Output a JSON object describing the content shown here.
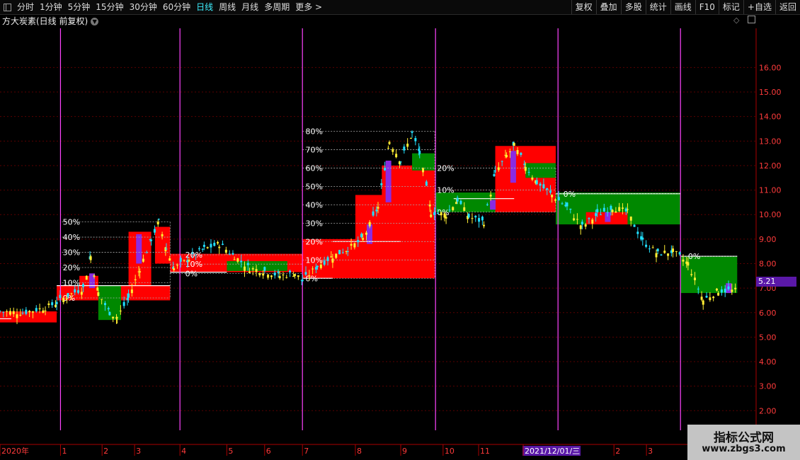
{
  "toolbar": {
    "periods": [
      "分时",
      "1分钟",
      "5分钟",
      "15分钟",
      "30分钟",
      "60分钟",
      "日线",
      "周线",
      "月线",
      "多周期",
      "更多"
    ],
    "active_period": "日线",
    "more_arrow": ">",
    "buttons": [
      "复权",
      "叠加",
      "多股",
      "统计",
      "画线",
      "F10",
      "标记",
      "+自选",
      "返回"
    ]
  },
  "title": {
    "stock": "方大炭素(日线 前复权)"
  },
  "price_axis": {
    "ticks": [
      "16.00",
      "15.00",
      "14.00",
      "13.00",
      "12.00",
      "11.00",
      "10.00",
      "9.00",
      "8.00",
      "7.00",
      "6.00",
      "5.00",
      "4.00",
      "3.00",
      "2.00"
    ]
  },
  "current_price": "5.21",
  "date_axis": {
    "labels": [
      "2020年",
      "1",
      "2",
      "3",
      "4",
      "5",
      "6",
      "7",
      "8",
      "9",
      "10",
      "11",
      "2021/12/01/三",
      "2",
      "3"
    ]
  },
  "chart_data": {
    "type": "candlestick",
    "y_range": [
      1.2,
      17.6
    ],
    "boxes": [
      {
        "x0": 0,
        "x1": 0.075,
        "lo": 5.6,
        "hi": 6.05,
        "color": "#ff0000"
      },
      {
        "x0": 0.075,
        "x1": 0.225,
        "lo": 6.5,
        "hi": 7.1,
        "color": "#ff0000"
      },
      {
        "x0": 0.105,
        "x1": 0.13,
        "lo": 7.0,
        "hi": 7.5,
        "color": "#ff0000"
      },
      {
        "x0": 0.13,
        "x1": 0.16,
        "lo": 5.7,
        "hi": 7.1,
        "color": "#008800"
      },
      {
        "x0": 0.17,
        "x1": 0.2,
        "lo": 7.0,
        "hi": 9.3,
        "color": "#ff0000"
      },
      {
        "x0": 0.205,
        "x1": 0.225,
        "lo": 8.0,
        "hi": 9.5,
        "color": "#ff0000"
      },
      {
        "x0": 0.225,
        "x1": 0.4,
        "lo": 7.65,
        "hi": 8.4,
        "color": "#ff0000"
      },
      {
        "x0": 0.3,
        "x1": 0.38,
        "lo": 7.7,
        "hi": 8.1,
        "color": "#008800"
      },
      {
        "x0": 0.4,
        "x1": 0.575,
        "lo": 7.4,
        "hi": 9.0,
        "color": "#ff0000"
      },
      {
        "x0": 0.47,
        "x1": 0.575,
        "lo": 8.9,
        "hi": 10.8,
        "color": "#ff0000"
      },
      {
        "x0": 0.505,
        "x1": 0.575,
        "lo": 10.5,
        "hi": 12.0,
        "color": "#ff0000"
      },
      {
        "x0": 0.545,
        "x1": 0.575,
        "lo": 11.8,
        "hi": 12.5,
        "color": "#008800"
      },
      {
        "x0": 0.575,
        "x1": 0.735,
        "lo": 10.1,
        "hi": 10.9,
        "color": "#008800"
      },
      {
        "x0": 0.655,
        "x1": 0.735,
        "lo": 10.1,
        "hi": 12.8,
        "color": "#ff0000"
      },
      {
        "x0": 0.695,
        "x1": 0.735,
        "lo": 11.5,
        "hi": 12.1,
        "color": "#008800"
      },
      {
        "x0": 0.735,
        "x1": 0.9,
        "lo": 9.6,
        "hi": 10.9,
        "color": "#008800"
      },
      {
        "x0": 0.775,
        "x1": 0.83,
        "lo": 9.6,
        "hi": 10.1,
        "color": "#ff0000"
      },
      {
        "x0": 0.9,
        "x1": 0.975,
        "lo": 6.8,
        "hi": 8.3,
        "color": "#008800"
      }
    ],
    "period_lines": [
      0.08,
      0.238,
      0.4,
      0.576,
      0.738,
      0.9
    ],
    "levels": [
      "0%",
      "10%",
      "20%",
      "30%",
      "40%",
      "50%",
      "60%",
      "70%",
      "80%"
    ],
    "price_path": [
      [
        0,
        6.05
      ],
      [
        0.03,
        6.0
      ],
      [
        0.06,
        6.2
      ],
      [
        0.075,
        6.4
      ],
      [
        0.09,
        6.7
      ],
      [
        0.11,
        7.0
      ],
      [
        0.12,
        8.3
      ],
      [
        0.13,
        6.8
      ],
      [
        0.145,
        6.0
      ],
      [
        0.155,
        5.8
      ],
      [
        0.17,
        6.6
      ],
      [
        0.185,
        7.8
      ],
      [
        0.2,
        9.0
      ],
      [
        0.21,
        9.7
      ],
      [
        0.22,
        8.6
      ],
      [
        0.23,
        7.8
      ],
      [
        0.25,
        8.2
      ],
      [
        0.27,
        8.6
      ],
      [
        0.29,
        8.8
      ],
      [
        0.31,
        8.3
      ],
      [
        0.33,
        7.8
      ],
      [
        0.35,
        7.7
      ],
      [
        0.37,
        7.5
      ],
      [
        0.39,
        7.6
      ],
      [
        0.4,
        7.3
      ],
      [
        0.42,
        7.9
      ],
      [
        0.44,
        8.3
      ],
      [
        0.46,
        8.6
      ],
      [
        0.48,
        9.0
      ],
      [
        0.5,
        10.3
      ],
      [
        0.515,
        13.0
      ],
      [
        0.53,
        12.2
      ],
      [
        0.545,
        13.3
      ],
      [
        0.555,
        12.5
      ],
      [
        0.57,
        10.1
      ],
      [
        0.59,
        10.0
      ],
      [
        0.605,
        10.6
      ],
      [
        0.62,
        9.9
      ],
      [
        0.64,
        9.7
      ],
      [
        0.655,
        11.7
      ],
      [
        0.67,
        12.4
      ],
      [
        0.68,
        12.8
      ],
      [
        0.695,
        12.0
      ],
      [
        0.71,
        11.3
      ],
      [
        0.73,
        10.8
      ],
      [
        0.75,
        10.3
      ],
      [
        0.77,
        9.5
      ],
      [
        0.79,
        10.0
      ],
      [
        0.81,
        10.3
      ],
      [
        0.83,
        10.1
      ],
      [
        0.85,
        8.9
      ],
      [
        0.87,
        8.4
      ],
      [
        0.89,
        8.5
      ],
      [
        0.91,
        8.0
      ],
      [
        0.93,
        6.5
      ],
      [
        0.95,
        6.9
      ],
      [
        0.975,
        6.9
      ]
    ]
  }
}
